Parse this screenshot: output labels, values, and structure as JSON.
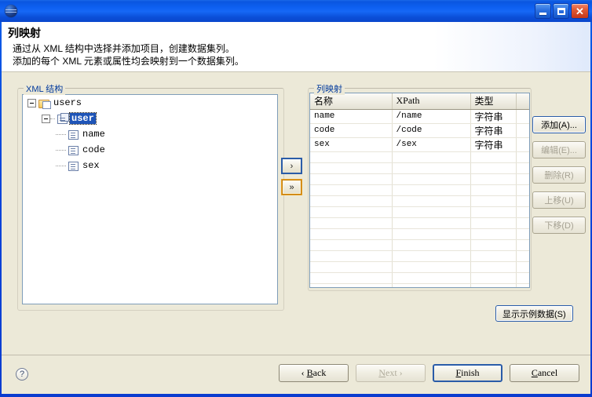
{
  "window": {
    "title": "",
    "app_icon": "eclipse-sphere-icon",
    "minimize_label": "",
    "maximize_label": "",
    "close_label": "✕"
  },
  "header": {
    "title": "列映射",
    "desc_line1": "通过从 XML 结构中选择并添加项目，创建数据集列。",
    "desc_line2": "添加的每个 XML 元素或属性均会映射到一个数据集列。"
  },
  "xml_group": {
    "label": "XML 结构",
    "tree": [
      {
        "label": "users",
        "depth": 0,
        "icon": "folder-icon",
        "expander": "collapse",
        "selected": false
      },
      {
        "label": "user",
        "depth": 1,
        "icon": "element-group-icon",
        "expander": "collapse",
        "selected": true
      },
      {
        "label": "name",
        "depth": 2,
        "icon": "element-icon",
        "expander": "none",
        "selected": false
      },
      {
        "label": "code",
        "depth": 2,
        "icon": "element-icon",
        "expander": "none",
        "selected": false
      },
      {
        "label": "sex",
        "depth": 2,
        "icon": "element-icon",
        "expander": "none",
        "selected": false
      }
    ]
  },
  "transfer_buttons": [
    {
      "name": "add-one-button",
      "label": "›",
      "state": "focused"
    },
    {
      "name": "add-all-button",
      "label": "»",
      "state": "hover"
    }
  ],
  "mapping_group": {
    "label": "列映射",
    "columns": [
      "名称",
      "XPath",
      "类型",
      ""
    ],
    "rows": [
      {
        "name": "name",
        "xpath": "/name",
        "type": "字符串",
        "extra": ""
      },
      {
        "name": "code",
        "xpath": "/code",
        "type": "字符串",
        "extra": ""
      },
      {
        "name": "sex",
        "xpath": "/sex",
        "type": "字符串",
        "extra": ""
      }
    ],
    "empty_row_count": 17
  },
  "side_buttons": [
    {
      "label": "添加(A)...",
      "enabled": true,
      "primary": true
    },
    {
      "label": "编辑(E)...",
      "enabled": false,
      "primary": false
    },
    {
      "label": "删除(R)",
      "enabled": false,
      "primary": false
    },
    {
      "label": "上移(U)",
      "enabled": false,
      "primary": false
    },
    {
      "label": "下移(D)",
      "enabled": false,
      "primary": false
    }
  ],
  "sample_button": {
    "label": "显示示例数据(S)"
  },
  "footer": {
    "help_icon": "question-mark-icon",
    "buttons": [
      {
        "name": "back-button",
        "prefix": "‹ ",
        "mnemonic": "B",
        "rest": "ack",
        "enabled": true,
        "default": false,
        "suffix": ""
      },
      {
        "name": "next-button",
        "prefix": "",
        "mnemonic": "N",
        "rest": "ext",
        "enabled": false,
        "default": false,
        "suffix": " ›"
      },
      {
        "name": "finish-button",
        "prefix": "",
        "mnemonic": "F",
        "rest": "inish",
        "enabled": true,
        "default": true,
        "suffix": ""
      },
      {
        "name": "cancel-button",
        "prefix": "",
        "mnemonic": "C",
        "rest": "ancel",
        "enabled": true,
        "default": false,
        "suffix": ""
      }
    ]
  },
  "colors": {
    "titlebar_blue": "#0a46dd",
    "body_beige": "#ece9d8",
    "group_label_blue": "#00399c",
    "selection_blue": "#1f55b8",
    "focus_border": "#2a5ca8",
    "hover_orange": "#e8a020"
  }
}
